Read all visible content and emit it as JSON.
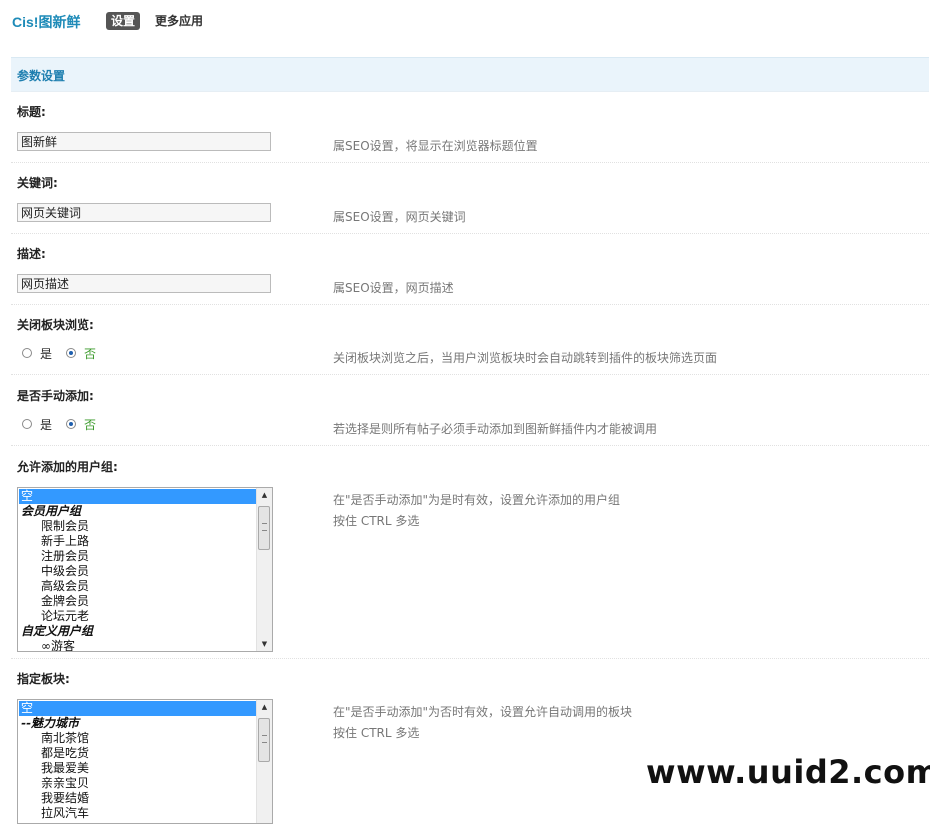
{
  "header": {
    "brand": "Cis!图新鲜",
    "tabs": [
      {
        "label": "设置"
      },
      {
        "label": "更多应用"
      }
    ]
  },
  "section_title": "参数设置",
  "fields": {
    "title": {
      "label": "标题:",
      "value": "图新鲜",
      "hint": "属SEO设置，将显示在浏览器标题位置"
    },
    "keywords": {
      "label": "关键词:",
      "value": "网页关键词",
      "hint": "属SEO设置，网页关键词"
    },
    "description": {
      "label": "描述:",
      "value": "网页描述",
      "hint": "属SEO设置，网页描述"
    },
    "close_browse": {
      "label": "关闭板块浏览:",
      "options": [
        "是",
        "否"
      ],
      "selected": "否",
      "hint": "关闭板块浏览之后，当用户浏览板块时会自动跳转到插件的板块筛选页面"
    },
    "manual_add": {
      "label": "是否手动添加:",
      "options": [
        "是",
        "否"
      ],
      "selected": "否",
      "hint": "若选择是则所有帖子必须手动添加到图新鲜插件内才能被调用"
    },
    "user_groups": {
      "label": "允许添加的用户组:",
      "hint_line1": "在\"是否手动添加\"为是时有效，设置允许添加的用户组",
      "hint_line2": "按住 CTRL 多选",
      "items": [
        "空",
        "会员用户组",
        "限制会员",
        "新手上路",
        "注册会员",
        "中级会员",
        "高级会员",
        "金牌会员",
        "论坛元老",
        "自定义用户组",
        "∞游客"
      ]
    },
    "forums": {
      "label": "指定板块:",
      "hint_line1": "在\"是否手动添加\"为否时有效，设置允许自动调用的板块",
      "hint_line2": "按住 CTRL 多选",
      "items": [
        "空",
        "--魅力城市",
        "南北茶馆",
        "都是吃货",
        "我最爱美",
        "亲亲宝贝",
        "我要结婚",
        "拉风汽车"
      ]
    }
  },
  "watermark": "www.uuid2.com"
}
